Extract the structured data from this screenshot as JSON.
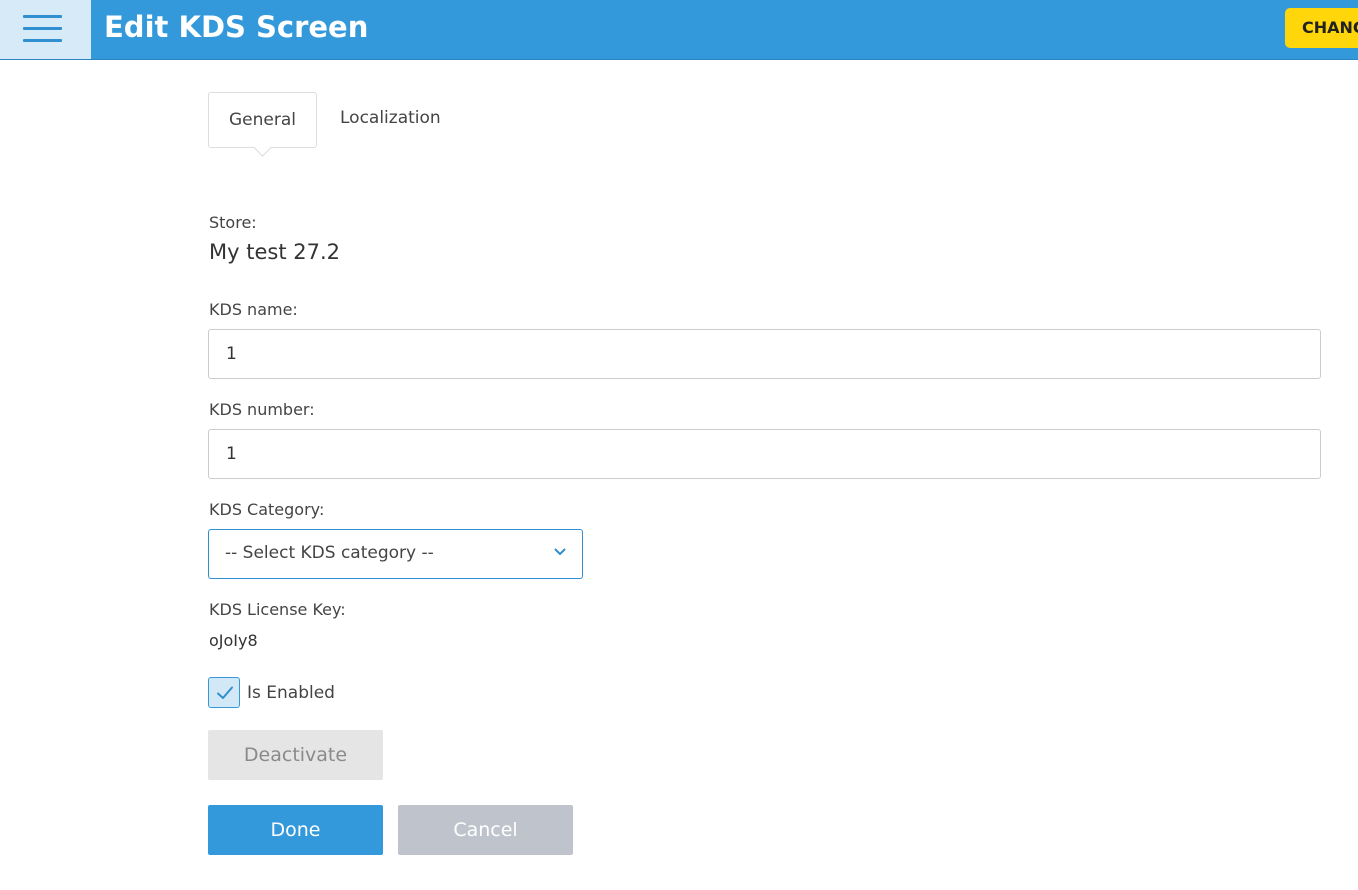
{
  "header": {
    "title": "Edit KDS Screen",
    "change_label": "CHANG"
  },
  "tabs": [
    {
      "label": "General",
      "active": true
    },
    {
      "label": "Localization",
      "active": false
    }
  ],
  "form": {
    "store_label": "Store:",
    "store_value": "My test 27.2",
    "kds_name_label": "KDS name:",
    "kds_name_value": "1",
    "kds_number_label": "KDS number:",
    "kds_number_value": "1",
    "kds_category_label": "KDS Category:",
    "kds_category_selected": "-- Select KDS category --",
    "license_key_label": "KDS License Key:",
    "license_key_value": "oJoIy8",
    "is_enabled_label": "Is Enabled",
    "is_enabled_checked": true
  },
  "buttons": {
    "deactivate": "Deactivate",
    "done": "Done",
    "cancel": "Cancel"
  },
  "icons": {
    "menu": "hamburger-menu-icon",
    "chevron": "chevron-down-icon",
    "check": "checkmark-icon"
  },
  "colors": {
    "primary": "#3399db",
    "accent_yellow": "#ffd60a",
    "disabled_gray": "#e5e5e5",
    "cancel_gray": "#bfc4cc"
  }
}
